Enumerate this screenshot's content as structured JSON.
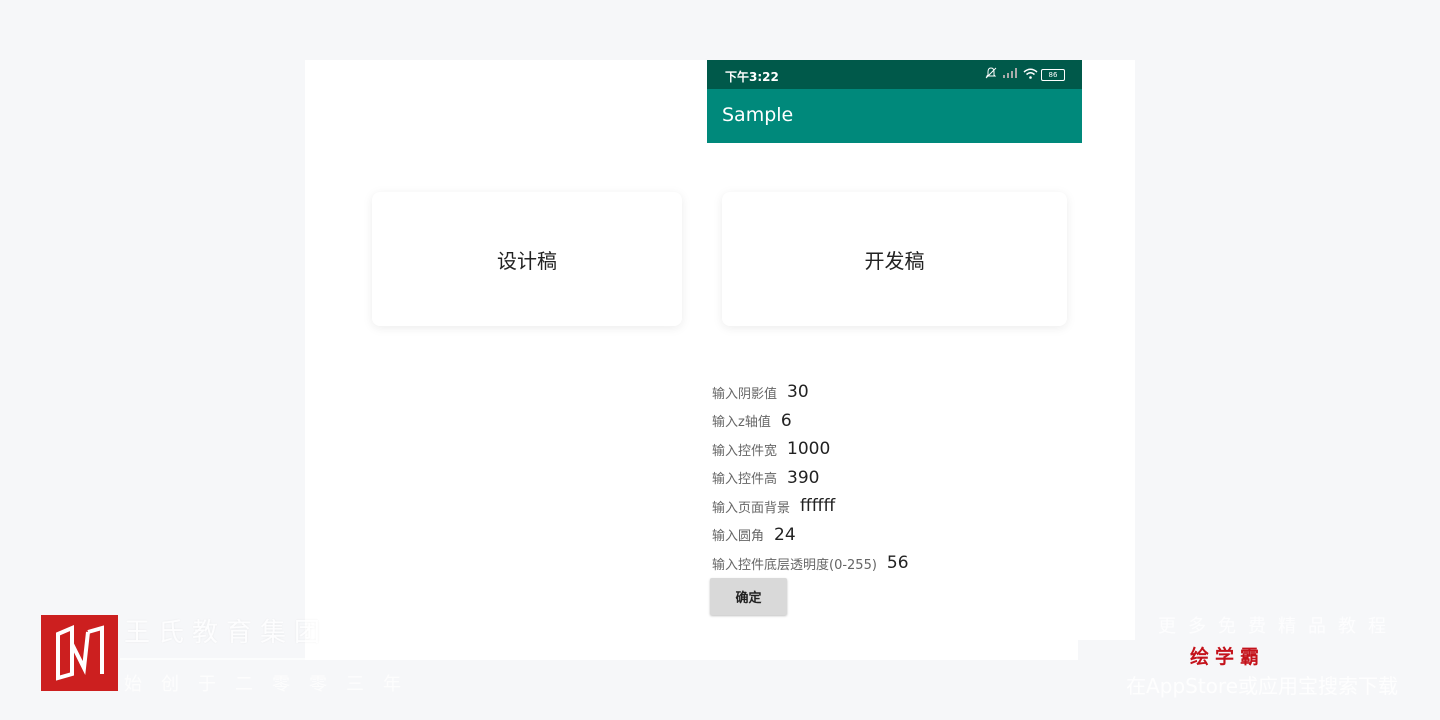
{
  "status_bar": {
    "time": "下午3:22",
    "battery": "86"
  },
  "app_bar": {
    "title": "Sample"
  },
  "cards": {
    "design": "设计稿",
    "dev": "开发稿"
  },
  "form": {
    "rows": [
      {
        "label": "输入阴影值",
        "value": "30"
      },
      {
        "label": "输入z轴值",
        "value": "6"
      },
      {
        "label": "输入控件宽",
        "value": "1000"
      },
      {
        "label": "输入控件高",
        "value": "390"
      },
      {
        "label": "输入页面背景",
        "value": "ffffff"
      },
      {
        "label": "输入圆角",
        "value": "24"
      },
      {
        "label": "输入控件底层透明度(0-255)",
        "value": "56"
      }
    ],
    "confirm_label": "确定"
  },
  "watermark": {
    "brand": "王氏教育集团",
    "slogan": "始创于二零零三年",
    "more": "更多免费精品教程",
    "app_name": "绘学霸",
    "download": "在AppStore或应用宝搜索下载"
  },
  "colors": {
    "status_bar_bg": "#00594a",
    "app_bar_bg": "#00897b",
    "logo_red": "#cc1f1f",
    "app_name_red": "#c4121b",
    "button_bg": "#d9d9d9"
  },
  "icons": [
    "mute-icon",
    "signal-icon",
    "wifi-icon",
    "battery-icon",
    "wangshi-logo-icon"
  ]
}
